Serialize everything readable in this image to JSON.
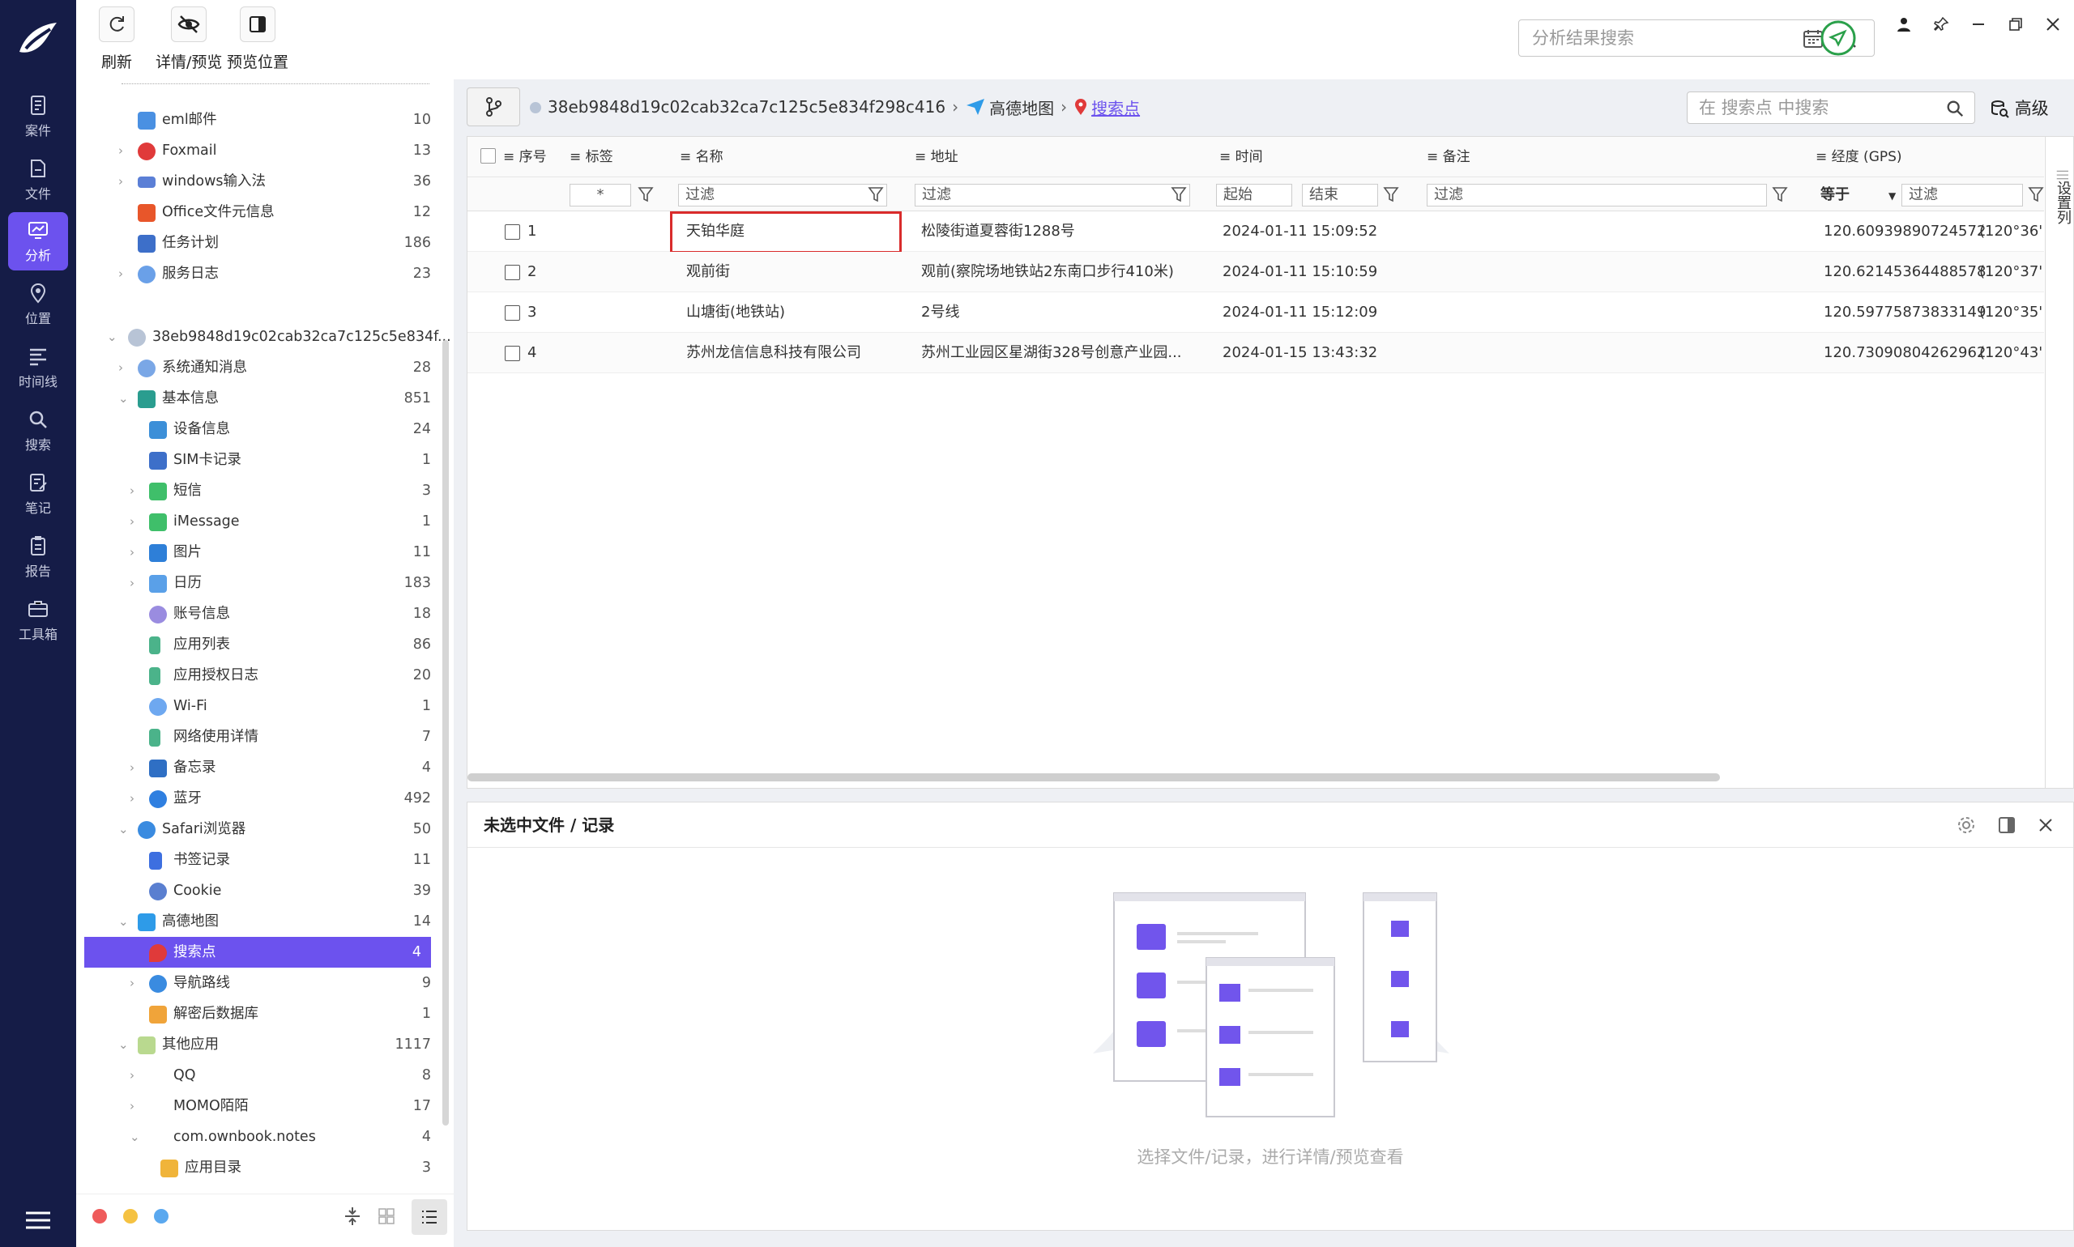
{
  "nav": {
    "items": [
      {
        "label": "案件",
        "icon": "case-icon"
      },
      {
        "label": "文件",
        "icon": "file-icon"
      },
      {
        "label": "分析",
        "icon": "analysis-icon",
        "active": true
      },
      {
        "label": "位置",
        "icon": "location-icon"
      },
      {
        "label": "时间线",
        "icon": "timeline-icon"
      },
      {
        "label": "搜索",
        "icon": "search-icon"
      },
      {
        "label": "笔记",
        "icon": "note-icon"
      },
      {
        "label": "报告",
        "icon": "report-icon"
      },
      {
        "label": "工具箱",
        "icon": "toolbox-icon"
      }
    ]
  },
  "toolbar": {
    "refresh": "刷新",
    "detail_preview": "详情/预览",
    "preview_position": "预览位置"
  },
  "global_search": {
    "placeholder": "分析结果搜索"
  },
  "tree": {
    "items": [
      {
        "label": "eml邮件",
        "count": "10"
      },
      {
        "label": "Foxmail",
        "count": "13"
      },
      {
        "label": "windows输入法",
        "count": "36"
      },
      {
        "label": "Office文件元信息",
        "count": "12"
      },
      {
        "label": "任务计划",
        "count": "186"
      },
      {
        "label": "服务日志",
        "count": "23"
      },
      {
        "label": "38eb9848d19c02cab32ca7c125c5e834f...",
        "count": ""
      },
      {
        "label": "系统通知消息",
        "count": "28"
      },
      {
        "label": "基本信息",
        "count": "851"
      },
      {
        "label": "设备信息",
        "count": "24"
      },
      {
        "label": "SIM卡记录",
        "count": "1"
      },
      {
        "label": "短信",
        "count": "3"
      },
      {
        "label": "iMessage",
        "count": "1"
      },
      {
        "label": "图片",
        "count": "11"
      },
      {
        "label": "日历",
        "count": "183"
      },
      {
        "label": "账号信息",
        "count": "18"
      },
      {
        "label": "应用列表",
        "count": "86"
      },
      {
        "label": "应用授权日志",
        "count": "20"
      },
      {
        "label": "Wi-Fi",
        "count": "1"
      },
      {
        "label": "网络使用详情",
        "count": "7"
      },
      {
        "label": "备忘录",
        "count": "4"
      },
      {
        "label": "蓝牙",
        "count": "492"
      },
      {
        "label": "Safari浏览器",
        "count": "50"
      },
      {
        "label": "书签记录",
        "count": "11"
      },
      {
        "label": "Cookie",
        "count": "39"
      },
      {
        "label": "高德地图",
        "count": "14"
      },
      {
        "label": "搜索点",
        "count": "4"
      },
      {
        "label": "导航路线",
        "count": "9"
      },
      {
        "label": "解密后数据库",
        "count": "1"
      },
      {
        "label": "其他应用",
        "count": "1117"
      },
      {
        "label": "QQ",
        "count": "8"
      },
      {
        "label": "MOMO陌陌",
        "count": "17"
      },
      {
        "label": "com.ownbook.notes",
        "count": "4"
      },
      {
        "label": "应用目录",
        "count": "3"
      }
    ]
  },
  "breadcrumb": {
    "device": "38eb9848d19c02cab32ca7c125c5e834f298c416",
    "app": "高德地图",
    "current": "搜索点"
  },
  "local_search": {
    "placeholder": "在 搜索点 中搜索"
  },
  "advanced": "高级",
  "grid": {
    "headers": {
      "seq": "序号",
      "tag": "标签",
      "name": "名称",
      "addr": "地址",
      "time": "时间",
      "note": "备注",
      "lng": "经度 (GPS)"
    },
    "filters": {
      "tag": "*",
      "name": "过滤",
      "addr": "过滤",
      "start": "起始",
      "end": "结束",
      "note": "过滤",
      "op": "等于",
      "lng": "过滤"
    },
    "rows": [
      {
        "seq": "1",
        "name": "天铂华庭",
        "addr": "松陵街道夏蓉街1288号",
        "time": "2024-01-11 15:09:52",
        "lng": "120.60939890724572",
        "dms": "(120°36'..."
      },
      {
        "seq": "2",
        "name": "观前街",
        "addr": "观前(察院场地铁站2东南口步行410米)",
        "time": "2024-01-11 15:10:59",
        "lng": "120.62145364488578",
        "dms": "(120°37'..."
      },
      {
        "seq": "3",
        "name": "山塘街(地铁站)",
        "addr": "2号线",
        "time": "2024-01-11 15:12:09",
        "lng": "120.59775873833149",
        "dms": "(120°35'..."
      },
      {
        "seq": "4",
        "name": "苏州龙信信息科技有限公司",
        "addr": "苏州工业园区星湖街328号创意产业园...",
        "time": "2024-01-15 13:43:32",
        "lng": "120.73090804262962",
        "dms": "(120°43'..."
      }
    ]
  },
  "column_settings": "设置列",
  "detail": {
    "title": "未选中文件 / 记录",
    "empty_hint": "选择文件/记录，进行详情/预览查看"
  }
}
